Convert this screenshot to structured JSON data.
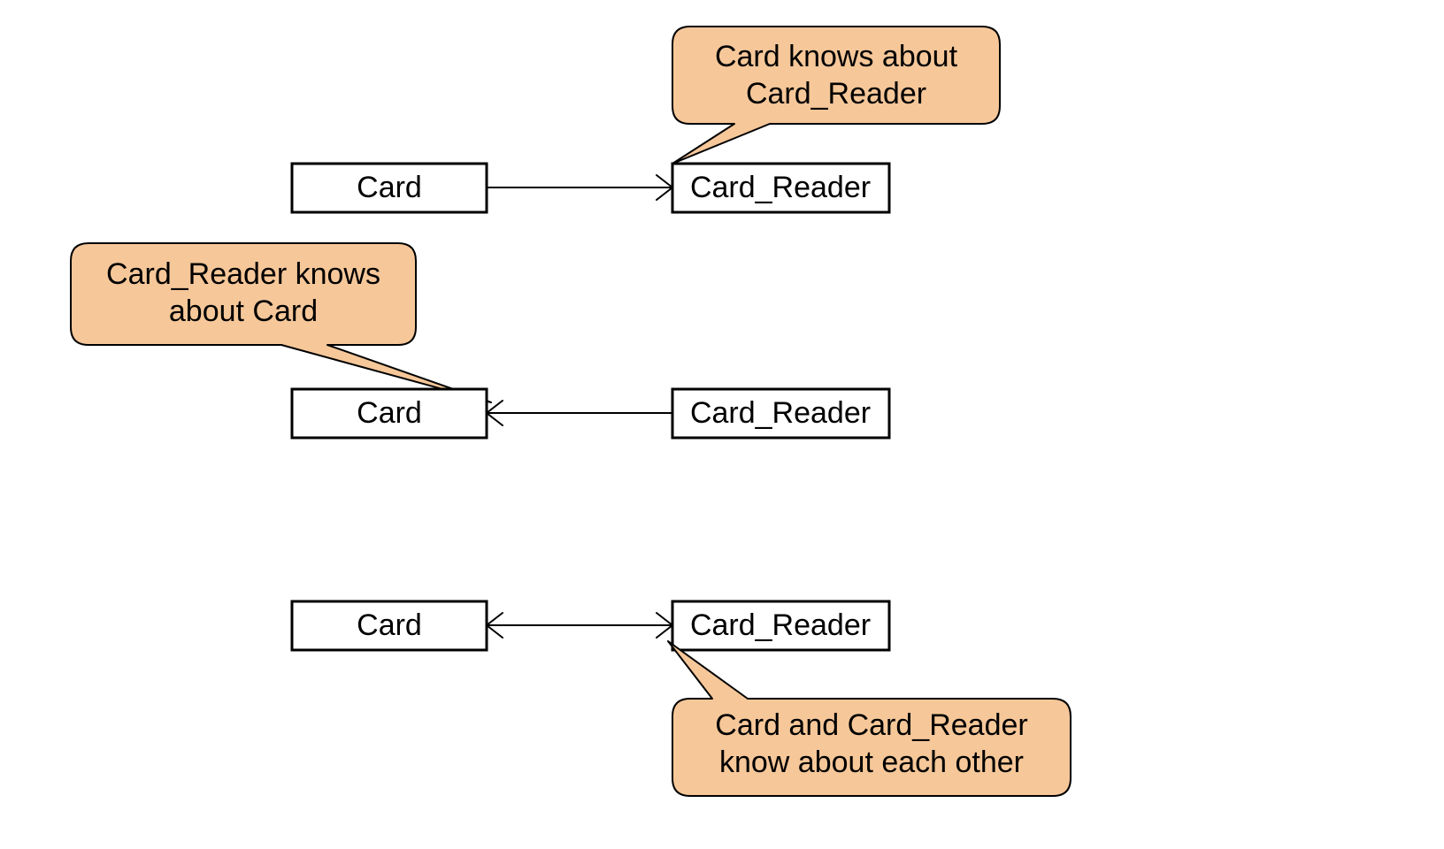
{
  "diagram": {
    "rows": [
      {
        "left_class": "Card",
        "right_class": "Card_Reader",
        "arrow": "right",
        "callout": {
          "line1": "Card knows about",
          "line2": "Card_Reader"
        }
      },
      {
        "left_class": "Card",
        "right_class": "Card_Reader",
        "arrow": "left",
        "callout": {
          "line1": "Card_Reader knows",
          "line2": "about Card"
        }
      },
      {
        "left_class": "Card",
        "right_class": "Card_Reader",
        "arrow": "both",
        "callout": {
          "line1": "Card and Card_Reader",
          "line2": "know about each other"
        }
      }
    ]
  }
}
